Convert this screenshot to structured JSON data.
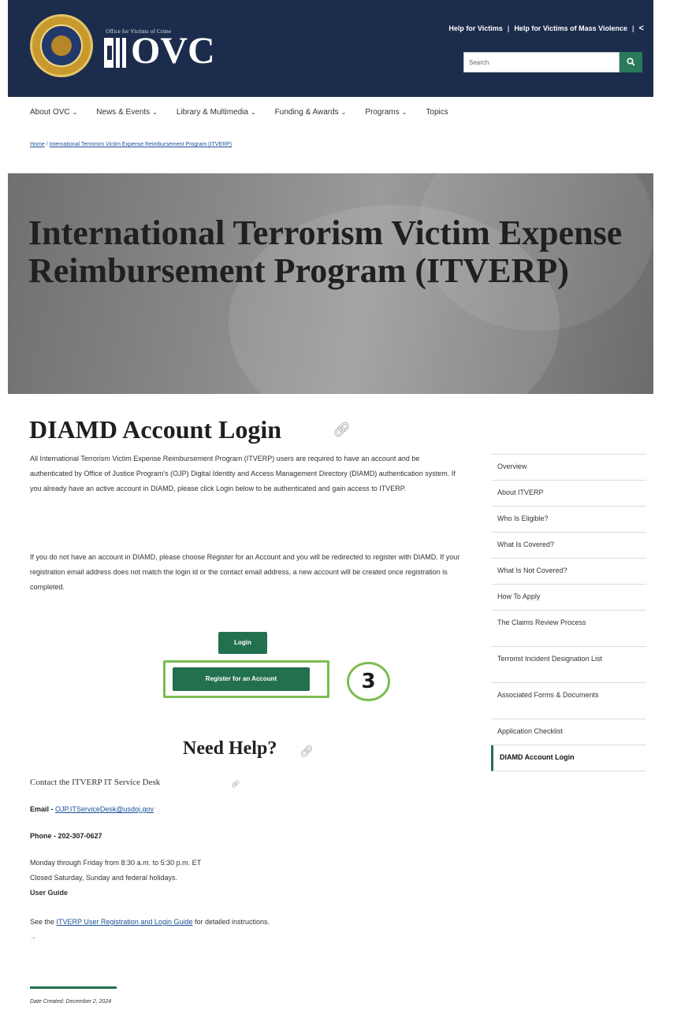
{
  "header": {
    "agency_small": "Office for Victims of Crime",
    "agency_logo": "OVC",
    "utility_links": [
      "Help for Victims",
      "Help for Victims of Mass Violence"
    ],
    "search_placeholder": "Search",
    "search_button_icon": "search-icon",
    "brand_color": "#1c2c4c",
    "accent_color": "#23704e"
  },
  "nav": {
    "items": [
      {
        "label": "About OVC",
        "has_dropdown": true
      },
      {
        "label": "News & Events",
        "has_dropdown": true
      },
      {
        "label": "Library & Multimedia",
        "has_dropdown": true
      },
      {
        "label": "Funding & Awards",
        "has_dropdown": true
      },
      {
        "label": "Programs",
        "has_dropdown": true
      },
      {
        "label": "Topics",
        "has_dropdown": false
      }
    ]
  },
  "breadcrumb": {
    "home": "Home",
    "current": "International Terrorism Victim Expense Reimbursement Program (ITVERP)"
  },
  "hero": {
    "title": "International Terrorism Victim Expense Reimbursement Program (ITVERP)"
  },
  "main": {
    "title": "DIAMD Account Login",
    "paragraph1": "All International Terrorism Victim Expense Reimbursement Program (ITVERP) users are required to have an account and be authenticated by Office of Justice Program's (OJP) Digital Identity and Access Management Directory (DIAMD) authentication system. If you already have an active account in DIAMD, please click Login below to be authenticated and gain access to ITVERP.",
    "paragraph2": "If you do not have an account in DIAMD, please choose Register for an Account and you will be redirected to register with DIAMD. If your registration email address does not match the login id or the contact email address, a new account will be created once registration is completed.",
    "login_button": "Login",
    "register_button": "Register for an Account",
    "step_number": "3"
  },
  "help": {
    "title": "Need Help?",
    "contact_title": "Contact the ITVERP IT Service Desk",
    "email_label": "Email -",
    "email": "OJP.ITServiceDesk@usdoj.gov",
    "phone": "Phone - 202-307-0627",
    "hours1": "Monday through Friday from 8:30 a.m. to 5:30 p.m. ET",
    "hours2": "Closed Saturday, Sunday and federal holidays.",
    "guide_heading": "User Guide",
    "guide_prefix": "See the",
    "guide_link": "ITVERP User Registration and Login Guide",
    "guide_suffix": "for detailed instructions.",
    "arrow": "→"
  },
  "footer": {
    "date_created": "Date Created: December 2, 2024"
  },
  "sidebar": {
    "items": [
      {
        "label": "Overview"
      },
      {
        "label": "About ITVERP"
      },
      {
        "label": "Who Is Eligible?"
      },
      {
        "label": "What Is Covered?"
      },
      {
        "label": "What Is Not Covered?"
      },
      {
        "label": "How To Apply"
      },
      {
        "label": "The Claims Review Process"
      },
      {
        "label": "Terrorist Incident Designation List"
      },
      {
        "label": "Associated Forms & Documents"
      },
      {
        "label": "Application Checklist"
      },
      {
        "label": "DIAMD Account Login",
        "active": true
      }
    ]
  }
}
